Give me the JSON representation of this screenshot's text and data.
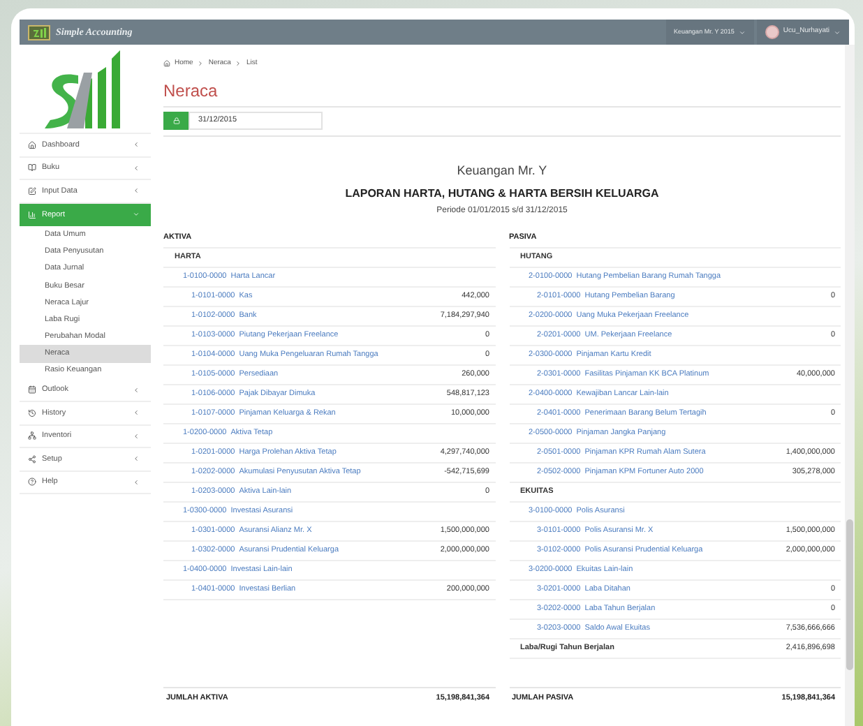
{
  "topbar": {
    "brand": "Simple Accounting",
    "ledger": "Keuangan Mr. Y 2015",
    "user": "Ucu_Nurhayati"
  },
  "sidebar": {
    "items": [
      {
        "label": "Dashboard",
        "expanded": false
      },
      {
        "label": "Buku",
        "expanded": false
      },
      {
        "label": "Input Data",
        "expanded": false
      },
      {
        "label": "Report",
        "expanded": true,
        "children": [
          {
            "label": "Data Umum",
            "selected": false
          },
          {
            "label": "Data Penyusutan",
            "selected": false
          },
          {
            "label": "Data Jurnal",
            "selected": false
          },
          {
            "label": "Buku Besar",
            "selected": false
          },
          {
            "label": "Neraca Lajur",
            "selected": false
          },
          {
            "label": "Laba Rugi",
            "selected": false
          },
          {
            "label": "Perubahan Modal",
            "selected": false
          },
          {
            "label": "Neraca",
            "selected": true
          },
          {
            "label": "Rasio Keuangan",
            "selected": false
          }
        ]
      },
      {
        "label": "Outlook",
        "expanded": false
      },
      {
        "label": "History",
        "expanded": false
      },
      {
        "label": "Inventori",
        "expanded": false
      },
      {
        "label": "Setup",
        "expanded": false
      },
      {
        "label": "Help",
        "expanded": false
      }
    ]
  },
  "breadcrumb": [
    "Home",
    "Neraca",
    "List"
  ],
  "page_title": "Neraca",
  "date_field": {
    "value": "31/12/2015"
  },
  "report": {
    "company": "Keuangan Mr. Y",
    "title": "LAPORAN HARTA, HUTANG & HARTA BERSIH KELUARGA",
    "period": "Periode 01/01/2015 s/d 31/12/2015",
    "columns": [
      {
        "heading": "AKTIVA",
        "rows": [
          {
            "kind": "section",
            "name": "HARTA"
          },
          {
            "kind": "group",
            "code": "1-0100-0000",
            "name": "Harta Lancar"
          },
          {
            "kind": "account",
            "code": "1-0101-0000",
            "name": "Kas",
            "value": "442,000"
          },
          {
            "kind": "account",
            "code": "1-0102-0000",
            "name": "Bank",
            "value": "7,184,297,940"
          },
          {
            "kind": "account",
            "code": "1-0103-0000",
            "name": "Piutang Pekerjaan Freelance",
            "value": "0"
          },
          {
            "kind": "account",
            "code": "1-0104-0000",
            "name": "Uang Muka Pengeluaran Rumah Tangga",
            "value": "0"
          },
          {
            "kind": "account",
            "code": "1-0105-0000",
            "name": "Persediaan",
            "value": "260,000"
          },
          {
            "kind": "account",
            "code": "1-0106-0000",
            "name": "Pajak Dibayar Dimuka",
            "value": "548,817,123"
          },
          {
            "kind": "account",
            "code": "1-0107-0000",
            "name": "Pinjaman Keluarga & Rekan",
            "value": "10,000,000"
          },
          {
            "kind": "group",
            "code": "1-0200-0000",
            "name": "Aktiva Tetap"
          },
          {
            "kind": "account",
            "code": "1-0201-0000",
            "name": "Harga Prolehan Aktiva Tetap",
            "value": "4,297,740,000"
          },
          {
            "kind": "account",
            "code": "1-0202-0000",
            "name": "Akumulasi Penyusutan Aktiva Tetap",
            "value": "-542,715,699"
          },
          {
            "kind": "account",
            "code": "1-0203-0000",
            "name": "Aktiva Lain-lain",
            "value": "0"
          },
          {
            "kind": "group",
            "code": "1-0300-0000",
            "name": "Investasi Asuransi"
          },
          {
            "kind": "account",
            "code": "1-0301-0000",
            "name": "Asuransi Alianz Mr. X",
            "value": "1,500,000,000"
          },
          {
            "kind": "account",
            "code": "1-0302-0000",
            "name": "Asuransi Prudential Keluarga",
            "value": "2,000,000,000"
          },
          {
            "kind": "group",
            "code": "1-0400-0000",
            "name": "Investasi Lain-lain"
          },
          {
            "kind": "account",
            "code": "1-0401-0000",
            "name": "Investasi Berlian",
            "value": "200,000,000"
          }
        ],
        "total_label": "JUMLAH AKTIVA",
        "total_value": "15,198,841,364"
      },
      {
        "heading": "PASIVA",
        "rows": [
          {
            "kind": "section",
            "name": "HUTANG"
          },
          {
            "kind": "group",
            "code": "2-0100-0000",
            "name": "Hutang Pembelian Barang Rumah Tangga"
          },
          {
            "kind": "account",
            "code": "2-0101-0000",
            "name": "Hutang Pembelian Barang",
            "value": "0"
          },
          {
            "kind": "group",
            "code": "2-0200-0000",
            "name": "Uang Muka Pekerjaan Freelance"
          },
          {
            "kind": "account",
            "code": "2-0201-0000",
            "name": "UM. Pekerjaan Freelance",
            "value": "0"
          },
          {
            "kind": "group",
            "code": "2-0300-0000",
            "name": "Pinjaman Kartu Kredit"
          },
          {
            "kind": "account",
            "code": "2-0301-0000",
            "name": "Fasilitas Pinjaman KK BCA Platinum",
            "value": "40,000,000"
          },
          {
            "kind": "group",
            "code": "2-0400-0000",
            "name": "Kewajiban Lancar Lain-lain"
          },
          {
            "kind": "account",
            "code": "2-0401-0000",
            "name": "Penerimaan Barang Belum Tertagih",
            "value": "0"
          },
          {
            "kind": "group",
            "code": "2-0500-0000",
            "name": "Pinjaman Jangka Panjang"
          },
          {
            "kind": "account",
            "code": "2-0501-0000",
            "name": "Pinjaman KPR Rumah Alam Sutera",
            "value": "1,400,000,000"
          },
          {
            "kind": "account",
            "code": "2-0502-0000",
            "name": "Pinjaman KPM Fortuner Auto 2000",
            "value": "305,278,000"
          },
          {
            "kind": "section",
            "name": "EKUITAS"
          },
          {
            "kind": "group",
            "code": "3-0100-0000",
            "name": "Polis Asuransi"
          },
          {
            "kind": "account",
            "code": "3-0101-0000",
            "name": "Polis Asuransi Mr. X",
            "value": "1,500,000,000"
          },
          {
            "kind": "account",
            "code": "3-0102-0000",
            "name": "Polis Asuransi Prudential Keluarga",
            "value": "2,000,000,000"
          },
          {
            "kind": "group",
            "code": "3-0200-0000",
            "name": "Ekuitas Lain-lain"
          },
          {
            "kind": "account",
            "code": "3-0201-0000",
            "name": "Laba Ditahan",
            "value": "0"
          },
          {
            "kind": "account",
            "code": "3-0202-0000",
            "name": "Laba Tahun Berjalan",
            "value": "0"
          },
          {
            "kind": "account",
            "code": "3-0203-0000",
            "name": "Saldo Awal Ekuitas",
            "value": "7,536,666,666"
          },
          {
            "kind": "subtotal",
            "name": "Laba/Rugi Tahun Berjalan",
            "value": "2,416,896,698"
          }
        ],
        "total_label": "JUMLAH PASIVA",
        "total_value": "15,198,841,364"
      }
    ]
  }
}
